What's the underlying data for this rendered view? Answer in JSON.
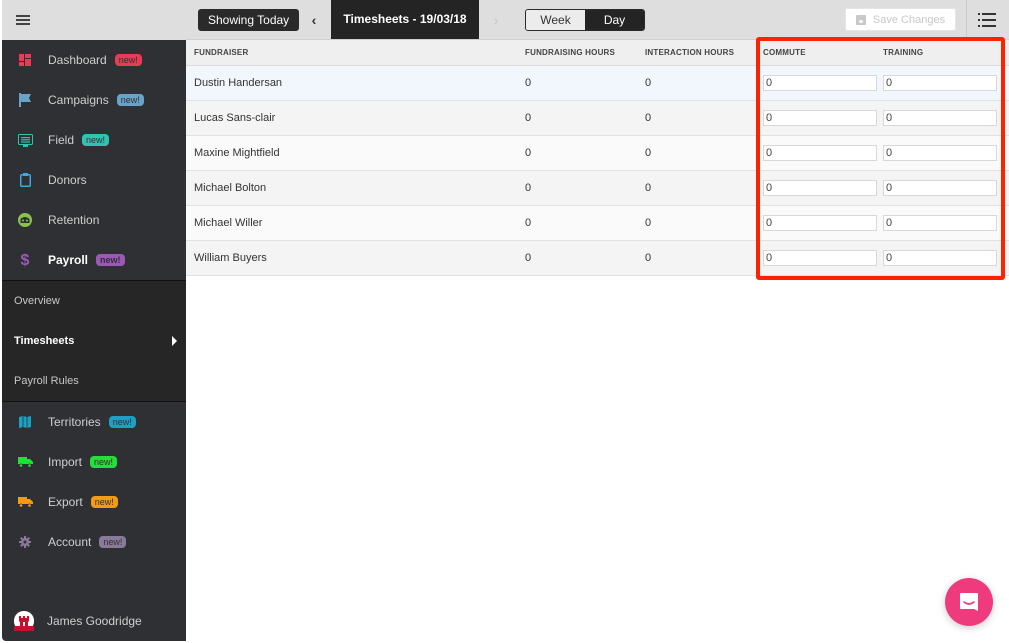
{
  "sidebar": {
    "menu_icon": "hamburger-icon",
    "items": [
      {
        "label": "Dashboard",
        "icon": "dashboard-icon",
        "badge": "new!",
        "badge_color": "#e63c55",
        "icon_color": "#e63c55"
      },
      {
        "label": "Campaigns",
        "icon": "flag-icon",
        "badge": "new!",
        "badge_color": "#6aa3c8",
        "icon_color": "#6aa3c8"
      },
      {
        "label": "Field",
        "icon": "field-icon",
        "badge": "new!",
        "badge_color": "#2ec4b0",
        "icon_color": "#2ec4b0"
      },
      {
        "label": "Donors",
        "icon": "clipboard-icon",
        "badge": null,
        "icon_color": "#3ea8e5"
      },
      {
        "label": "Retention",
        "icon": "retention-face-icon",
        "badge": null,
        "icon_color": "#8bc34a"
      },
      {
        "label": "Payroll",
        "icon": "dollar-icon",
        "badge": "new!",
        "badge_color": "#9b59b6",
        "icon_color": "#9b59b6",
        "active": true
      },
      {
        "label": "Territories",
        "icon": "map-icon",
        "badge": "new!",
        "badge_color": "#1ba1c4",
        "icon_color": "#1ba1c4"
      },
      {
        "label": "Import",
        "icon": "truck-icon",
        "badge": "new!",
        "badge_color": "#22e03a",
        "icon_color": "#22e03a"
      },
      {
        "label": "Export",
        "icon": "truck-icon",
        "badge": "new!",
        "badge_color": "#f39c12",
        "icon_color": "#f39c12"
      },
      {
        "label": "Account",
        "icon": "gear-icon",
        "badge": "new!",
        "badge_color": "#8a7a9a",
        "icon_color": "#8a7a9a"
      }
    ],
    "payroll_submenu": [
      {
        "label": "Overview"
      },
      {
        "label": "Timesheets",
        "active": true
      },
      {
        "label": "Payroll Rules"
      }
    ],
    "user": {
      "name": "James Goodridge",
      "avatar_icon": "castle-icon"
    }
  },
  "toolbar": {
    "showing_today": "Showing Today",
    "title": "Timesheets - 19/03/18",
    "prev": "‹",
    "next": "›",
    "view_toggle": {
      "options": [
        "Week",
        "Day"
      ],
      "selected": "Day"
    },
    "save_label": "Save Changes",
    "list_icon": "list-icon"
  },
  "table": {
    "columns": [
      "FUNDRAISER",
      "FUNDRAISING HOURS",
      "INTERACTION HOURS",
      "COMMUTE",
      "TRAINING"
    ],
    "rows": [
      {
        "name": "Dustin Handersan",
        "fundraising_hours": "0",
        "interaction_hours": "0",
        "commute": "0",
        "training": "0"
      },
      {
        "name": "Lucas Sans-clair",
        "fundraising_hours": "0",
        "interaction_hours": "0",
        "commute": "0",
        "training": "0"
      },
      {
        "name": "Maxine Mightfield",
        "fundraising_hours": "0",
        "interaction_hours": "0",
        "commute": "0",
        "training": "0"
      },
      {
        "name": "Michael Bolton",
        "fundraising_hours": "0",
        "interaction_hours": "0",
        "commute": "0",
        "training": "0"
      },
      {
        "name": "Michael Willer",
        "fundraising_hours": "0",
        "interaction_hours": "0",
        "commute": "0",
        "training": "0"
      },
      {
        "name": "William Buyers",
        "fundraising_hours": "0",
        "interaction_hours": "0",
        "commute": "0",
        "training": "0"
      }
    ]
  },
  "annotation": {
    "highlight_color": "#ff2200",
    "highlights": [
      "COMMUTE",
      "TRAINING"
    ]
  },
  "chat_widget": {
    "icon": "chat-icon",
    "color": "#ee3b7d"
  }
}
